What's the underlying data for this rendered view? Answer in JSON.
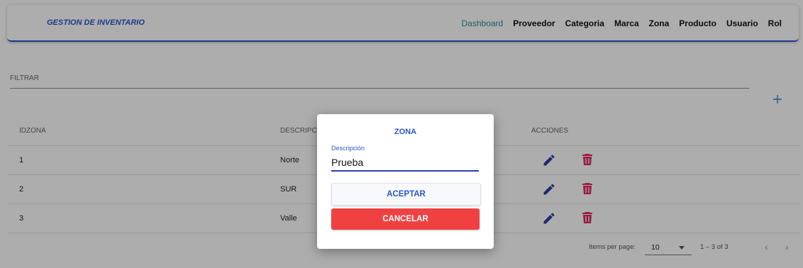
{
  "navbar": {
    "brand": "GESTION DE INVENTARIO",
    "items": [
      {
        "label": "Dashboard",
        "active": true
      },
      {
        "label": "Proveedor"
      },
      {
        "label": "Categoria"
      },
      {
        "label": "Marca"
      },
      {
        "label": "Zona"
      },
      {
        "label": "Producto"
      },
      {
        "label": "Usuario"
      },
      {
        "label": "Rol"
      }
    ]
  },
  "filter": {
    "label": "FILTRAR",
    "add_icon": "plus-icon"
  },
  "table": {
    "headers": {
      "id": "IDZONA",
      "desc": "DESCRIPCION",
      "actions": "ACCIONES"
    },
    "rows": [
      {
        "id": "1",
        "desc": "Norte"
      },
      {
        "id": "2",
        "desc": "SUR"
      },
      {
        "id": "3",
        "desc": "Valle"
      }
    ]
  },
  "paginator": {
    "items_per_page_label": "Items per page:",
    "page_size": "10",
    "range": "1 – 3 of 3"
  },
  "dialog": {
    "title": "ZONA",
    "field_label": "Descripción",
    "field_value": "Prueba",
    "accept": "ACEPTAR",
    "cancel": "CANCELAR"
  },
  "colors": {
    "brand_blue": "#2c56c9",
    "active_nav": "#2b8a8f",
    "edit_icon": "#2a3fa6",
    "delete_icon": "#e02a62",
    "cancel_button": "#ef4141"
  }
}
